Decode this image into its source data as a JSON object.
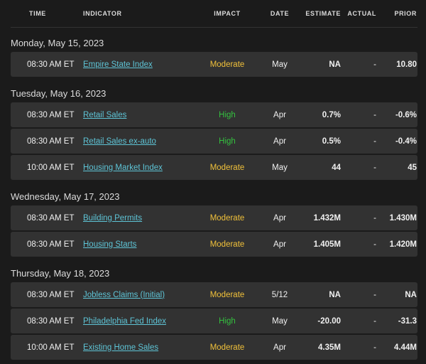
{
  "header": {
    "time": "TIME",
    "indicator": "INDICATOR",
    "impact": "IMPACT",
    "date": "DATE",
    "estimate": "ESTIMATE",
    "actual": "ACTUAL",
    "prior": "PRIOR"
  },
  "colors": {
    "moderate": "#f0c03a",
    "high": "#34c23f",
    "link": "#5ec4d6"
  },
  "groups": [
    {
      "date": "Monday, May 15, 2023",
      "rows": [
        {
          "time": "08:30 AM ET",
          "indicator": "Empire State Index",
          "impact": "Moderate",
          "date": "May",
          "estimate": "NA",
          "actual": "-",
          "prior": "10.80"
        }
      ]
    },
    {
      "date": "Tuesday, May 16, 2023",
      "rows": [
        {
          "time": "08:30 AM ET",
          "indicator": "Retail Sales",
          "impact": "High",
          "date": "Apr",
          "estimate": "0.7%",
          "actual": "-",
          "prior": "-0.6%"
        },
        {
          "time": "08:30 AM ET",
          "indicator": "Retail Sales ex-auto",
          "impact": "High",
          "date": "Apr",
          "estimate": "0.5%",
          "actual": "-",
          "prior": "-0.4%"
        },
        {
          "time": "10:00 AM ET",
          "indicator": "Housing Market Index",
          "impact": "Moderate",
          "date": "May",
          "estimate": "44",
          "actual": "-",
          "prior": "45"
        }
      ]
    },
    {
      "date": "Wednesday, May 17, 2023",
      "rows": [
        {
          "time": "08:30 AM ET",
          "indicator": "Building Permits",
          "impact": "Moderate",
          "date": "Apr",
          "estimate": "1.432M",
          "actual": "-",
          "prior": "1.430M"
        },
        {
          "time": "08:30 AM ET",
          "indicator": "Housing Starts",
          "impact": "Moderate",
          "date": "Apr",
          "estimate": "1.405M",
          "actual": "-",
          "prior": "1.420M"
        }
      ]
    },
    {
      "date": "Thursday, May 18, 2023",
      "rows": [
        {
          "time": "08:30 AM ET",
          "indicator": "Jobless Claims (Initial)",
          "impact": "Moderate",
          "date": "5/12",
          "estimate": "NA",
          "actual": "-",
          "prior": "NA"
        },
        {
          "time": "08:30 AM ET",
          "indicator": "Philadelphia Fed Index",
          "impact": "High",
          "date": "May",
          "estimate": "-20.00",
          "actual": "-",
          "prior": "-31.3"
        },
        {
          "time": "10:00 AM ET",
          "indicator": "Existing Home Sales",
          "impact": "Moderate",
          "date": "Apr",
          "estimate": "4.35M",
          "actual": "-",
          "prior": "4.44M"
        }
      ]
    }
  ]
}
